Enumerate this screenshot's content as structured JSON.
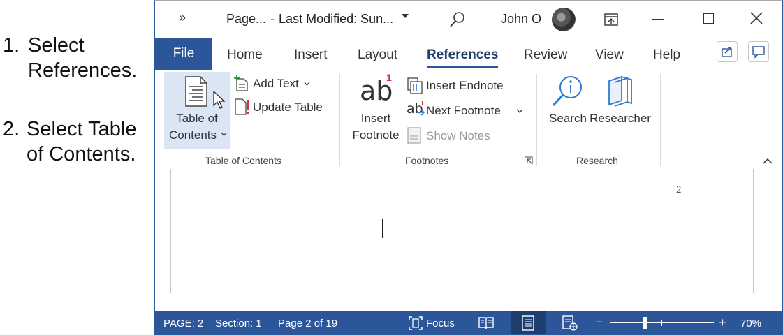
{
  "instructions": {
    "step1": {
      "number": "1.",
      "line1": "Select",
      "line2": "References."
    },
    "step2": {
      "number": "2.",
      "line1": "Select Table",
      "line2": "of Contents."
    }
  },
  "titlebar": {
    "more_icon": "chevrons-right-icon",
    "doc_name": "Page...",
    "separator": "-",
    "last_modified": "Last Modified: Sun...",
    "user_name": "John O"
  },
  "tabs": [
    "File",
    "Home",
    "Insert",
    "Layout",
    "References",
    "Review",
    "View",
    "Help"
  ],
  "active_tab": "References",
  "ribbon": {
    "toc": {
      "table_of_contents_line1": "Table of",
      "table_of_contents_line2": "Contents",
      "add_text": "Add Text",
      "update_table": "Update Table",
      "group_label": "Table of Contents"
    },
    "footnotes": {
      "insert_footnote_icon_text": "ab",
      "insert_footnote_superscript": "1",
      "insert_footnote_line1": "Insert",
      "insert_footnote_line2": "Footnote",
      "insert_endnote": "Insert Endnote",
      "next_footnote_icon_text": "ab",
      "next_footnote": "Next Footnote",
      "show_notes": "Show Notes",
      "group_label": "Footnotes"
    },
    "research": {
      "search": "Search",
      "researcher": "Researcher",
      "group_label": "Research"
    }
  },
  "document": {
    "page_number": "2"
  },
  "statusbar": {
    "page": "PAGE: 2",
    "section": "Section: 1",
    "page_of": "Page 2 of 19",
    "focus": "Focus",
    "zoom_minus": "−",
    "zoom_plus": "+",
    "zoom": "70%",
    "zoom_fraction": 0.7
  },
  "colors": {
    "accent": "#2b579a",
    "toc_highlight": "#dbe6f4",
    "footnote_red": "#d13438",
    "icon_blue": "#2b7cd3"
  }
}
